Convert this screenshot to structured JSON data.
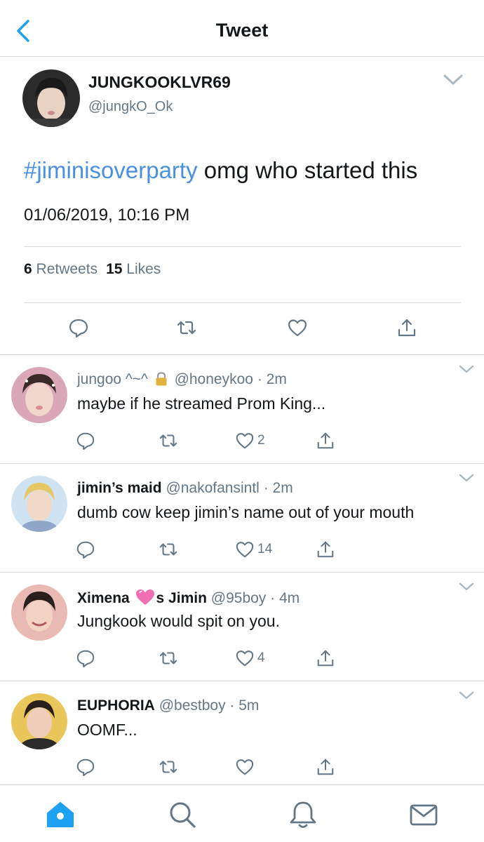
{
  "colors": {
    "accent": "#1da1f2",
    "hashtag": "#4a90e2",
    "text": "#14171a",
    "muted": "#657786",
    "divider": "#d8dce0"
  },
  "nav": {
    "title": "Tweet",
    "back_icon": "chevron-left-icon"
  },
  "tweet": {
    "author_name": "JUNGKOOKLVR69",
    "author_handle": "@jungkO_Ok",
    "hashtag": "#jiminisoverparty",
    "text": " omg who started this",
    "timestamp": "01/06/2019, 10:16 PM",
    "retweet_count": "6",
    "retweet_label": "Retweets",
    "like_count": "15",
    "like_label": "Likes",
    "actions": [
      "reply-icon",
      "retweet-icon",
      "like-icon",
      "share-icon"
    ]
  },
  "replies": [
    {
      "name": "jungoo ^~^",
      "lock_emoji": "🔒",
      "handle": "@honeykoo",
      "time": "· 2m",
      "text": "maybe if he streamed Prom King...",
      "reply_count": "",
      "retweet_count": "",
      "like_count": "2"
    },
    {
      "name": "jimin’s maid",
      "handle": "@nakofansintl",
      "time": "· 2m",
      "text": "dumb cow keep jimin’s name out of your mouth",
      "like_count": "14"
    },
    {
      "name_part1": "Ximena",
      "emoji": "💗",
      "name_part2": "s Jimin",
      "handle": "@95boy",
      "time": "· 4m",
      "text": "Jungkook would spit on you.",
      "like_count": "4"
    },
    {
      "name": "EUPHORIA",
      "handle": "@bestboy",
      "time": "· 5m",
      "text": "OOMF...",
      "like_count": ""
    }
  ],
  "tabbar": {
    "tabs": [
      "home-icon",
      "search-icon",
      "notifications-icon",
      "messages-icon"
    ],
    "active": "home-icon"
  }
}
